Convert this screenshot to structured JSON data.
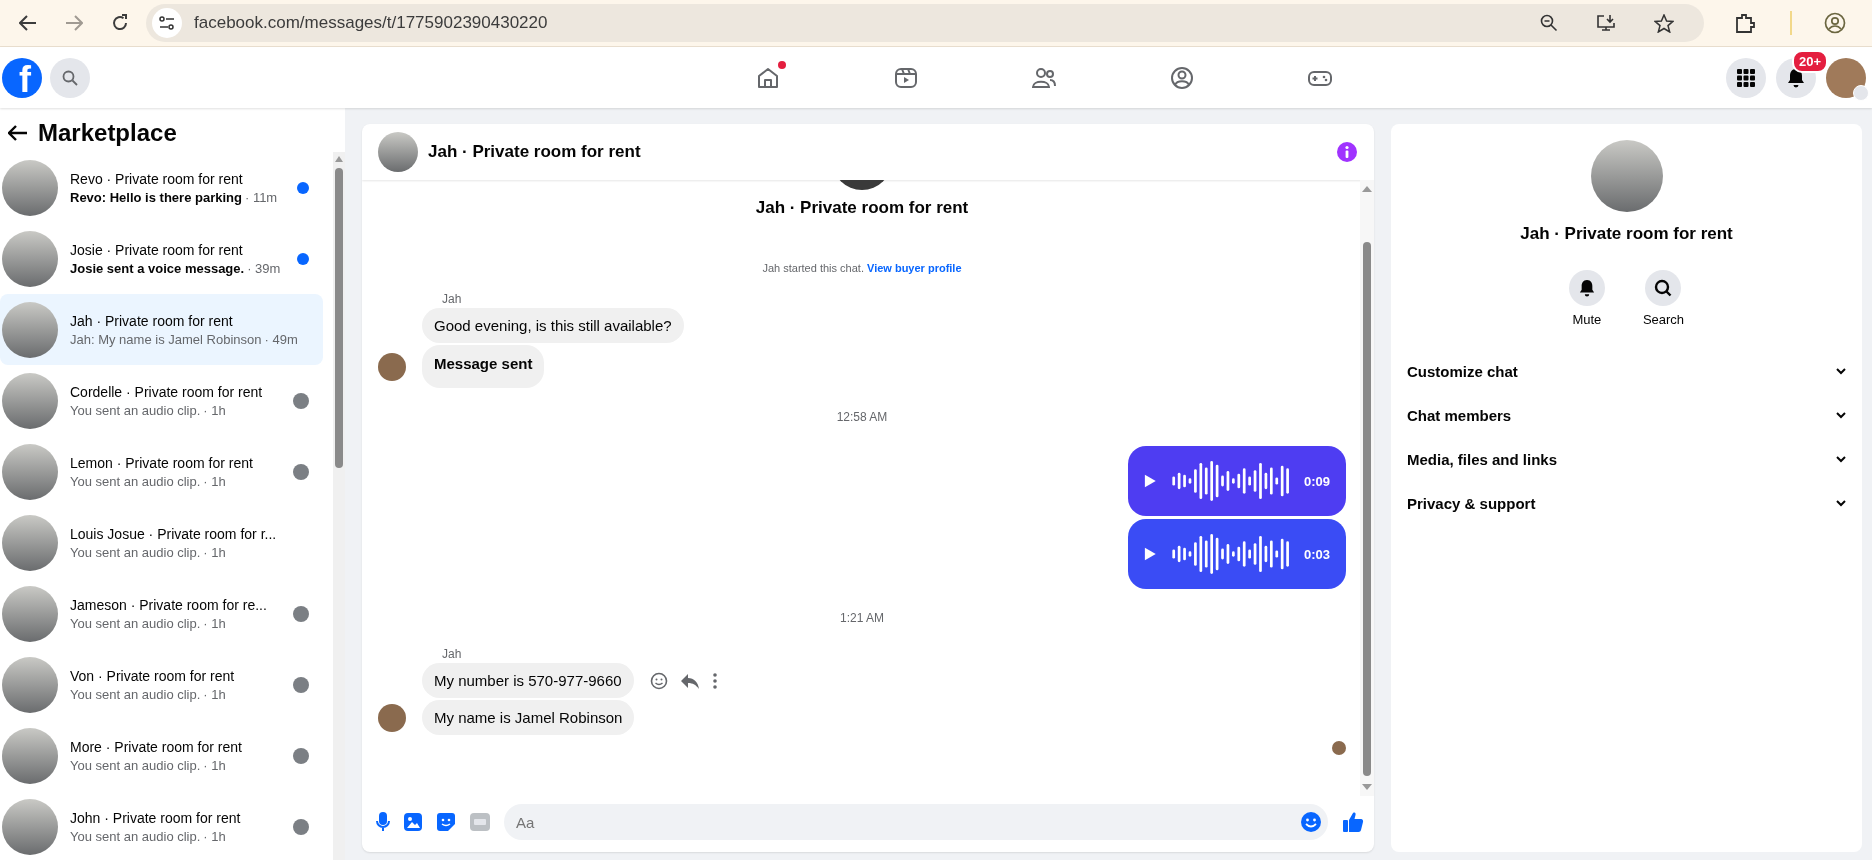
{
  "browser": {
    "url": "facebook.com/messages/t/1775902390430220"
  },
  "topbar": {
    "logo": "f",
    "nav": [
      {
        "unread": true
      },
      {
        "unread": false
      },
      {
        "unread": false
      },
      {
        "unread": false
      },
      {
        "unread": false
      }
    ],
    "notification_badge": "20+"
  },
  "sidebar": {
    "title": "Marketplace",
    "conversations": [
      {
        "title": "Revo · Private room for rent",
        "preview": "Revo: Hello is there parking",
        "time": "· 11m",
        "unread": true,
        "selected": false,
        "seen": false
      },
      {
        "title": "Josie · Private room for rent",
        "preview": "Josie sent a voice message.",
        "time": "· 39m",
        "unread": true,
        "selected": false,
        "seen": false
      },
      {
        "title": "Jah · Private room for rent",
        "preview": "Jah: My name is Jamel Robinson",
        "time": "· 49m",
        "unread": false,
        "selected": true,
        "seen": false
      },
      {
        "title": "Cordelle · Private room for rent",
        "preview": "You sent an audio clip.",
        "time": "· 1h",
        "unread": false,
        "selected": false,
        "seen": true
      },
      {
        "title": "Lemon · Private room for rent",
        "preview": "You sent an audio clip.",
        "time": "· 1h",
        "unread": false,
        "selected": false,
        "seen": true
      },
      {
        "title": "Louis Josue · Private room for r...",
        "preview": "You sent an audio clip.",
        "time": "· 1h",
        "unread": false,
        "selected": false,
        "seen": false
      },
      {
        "title": "Jameson · Private room for re...",
        "preview": "You sent an audio clip.",
        "time": "· 1h",
        "unread": false,
        "selected": false,
        "seen": true
      },
      {
        "title": "Von · Private room for rent",
        "preview": "You sent an audio clip.",
        "time": "· 1h",
        "unread": false,
        "selected": false,
        "seen": true
      },
      {
        "title": "More · Private room for rent",
        "preview": "You sent an audio clip.",
        "time": "· 1h",
        "unread": false,
        "selected": false,
        "seen": true
      },
      {
        "title": "John · Private room for rent",
        "preview": "You sent an audio clip.",
        "time": "· 1h",
        "unread": false,
        "selected": false,
        "seen": true
      }
    ]
  },
  "chat": {
    "title": "Jah · Private room for rent",
    "thread": [
      {
        "kind": "intro",
        "title": "Jah · Private room for rent"
      },
      {
        "kind": "system",
        "text": "Jah started this chat.",
        "link": "View buyer profile"
      },
      {
        "kind": "incoming",
        "sender": "Jah",
        "messages": [
          {
            "text": "Good evening, is this still available?",
            "bold": false,
            "show_actions": false
          },
          {
            "text": "Message sent",
            "bold": true,
            "show_actions": false
          }
        ]
      },
      {
        "kind": "timestamp",
        "text": "12:58 AM"
      },
      {
        "kind": "outgoing_audio",
        "clips": [
          {
            "duration": "0:09"
          },
          {
            "duration": "0:03"
          }
        ]
      },
      {
        "kind": "timestamp",
        "text": "1:21 AM"
      },
      {
        "kind": "incoming",
        "sender": "Jah",
        "messages": [
          {
            "text": "My number is 570-977-9660",
            "bold": false,
            "show_actions": true
          },
          {
            "text": "My name is Jamel Robinson",
            "bold": false,
            "show_actions": false
          }
        ]
      },
      {
        "kind": "seen"
      }
    ],
    "composer": {
      "placeholder": "Aa"
    }
  },
  "details": {
    "title": "Jah · Private room for rent",
    "actions": [
      {
        "label": "Mute"
      },
      {
        "label": "Search"
      }
    ],
    "sections": [
      {
        "label": "Customize chat",
        "expanded": false
      },
      {
        "label": "Chat members",
        "expanded": false
      },
      {
        "label": "Media, files and links",
        "expanded": false
      },
      {
        "label": "Privacy & support",
        "expanded": false
      }
    ]
  }
}
